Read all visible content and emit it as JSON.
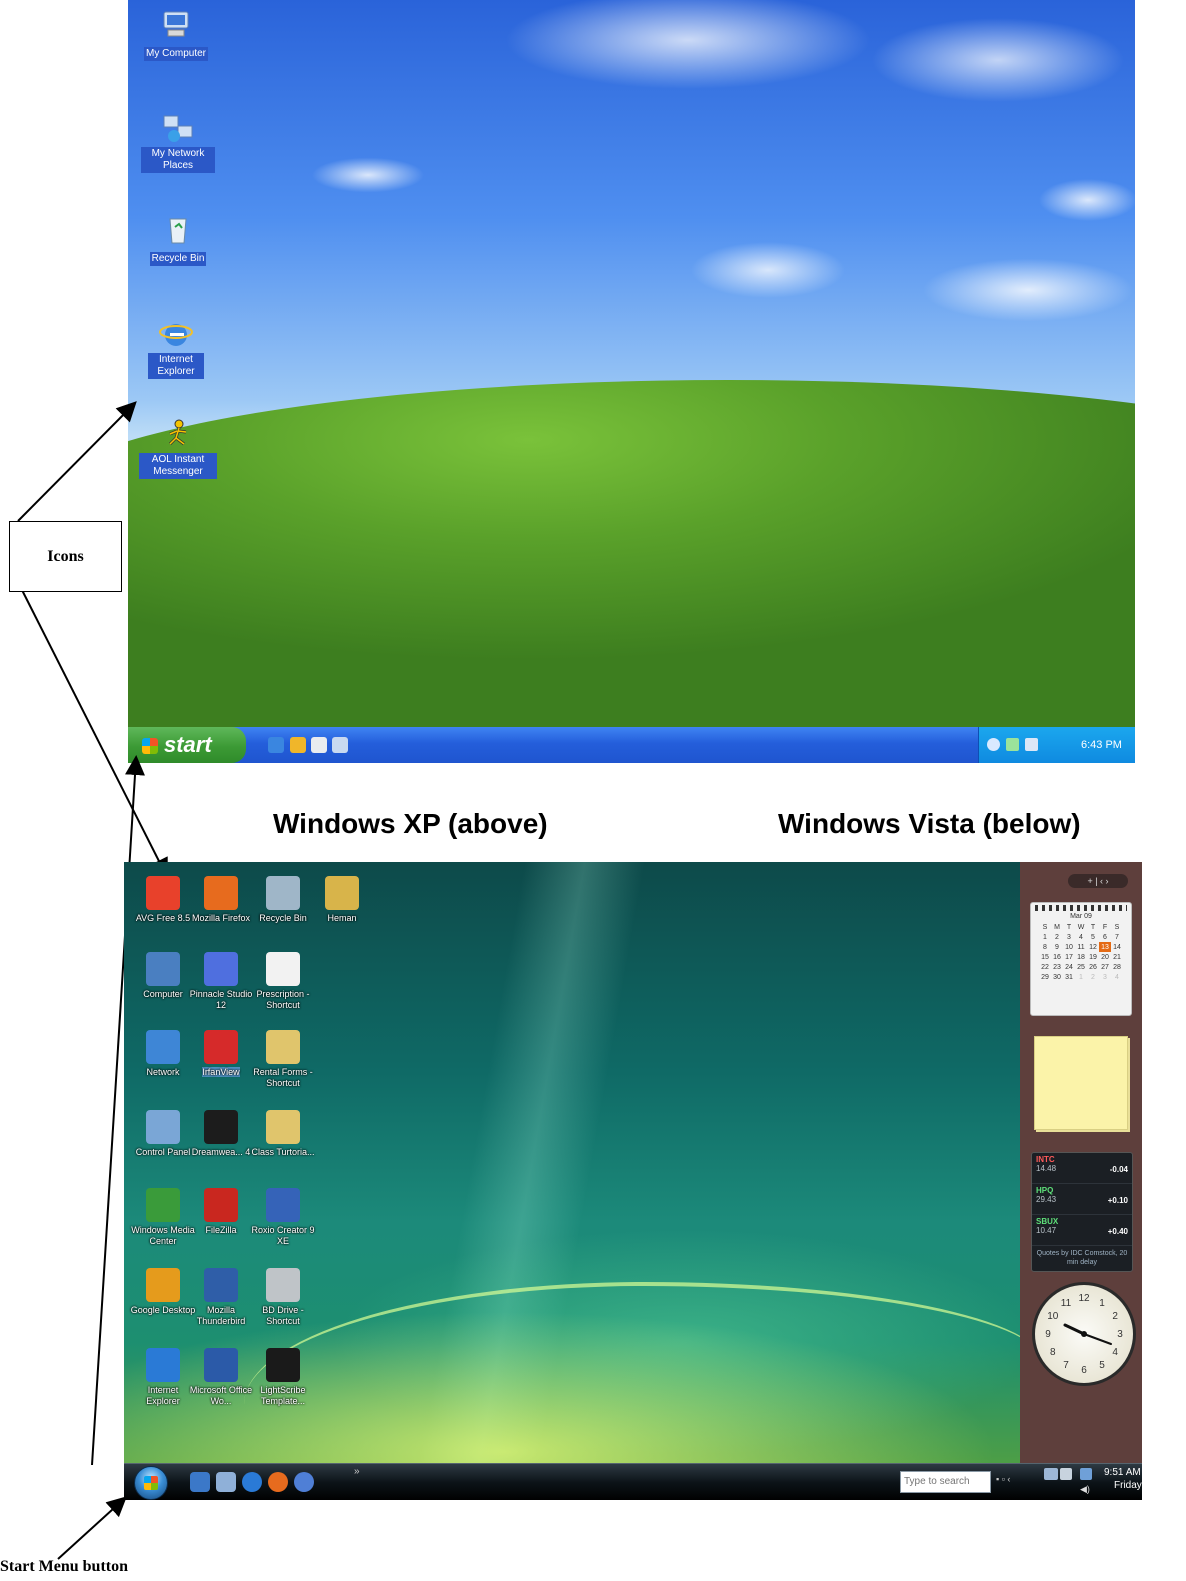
{
  "annotations": {
    "icons_label": "Icons",
    "xp_caption": "Windows XP (above)",
    "vista_caption": "Windows Vista (below)",
    "start_label": "Start Menu button"
  },
  "xp": {
    "icons": [
      {
        "name": "My Computer",
        "icon": "computer-icon"
      },
      {
        "name": "My Network Places",
        "icon": "network-places-icon"
      },
      {
        "name": "Recycle Bin",
        "icon": "recycle-bin-icon"
      },
      {
        "name": "Internet Explorer",
        "icon": "internet-explorer-icon"
      },
      {
        "name": "AOL Instant Messenger",
        "icon": "aim-icon"
      }
    ],
    "start_label": "start",
    "clock": "6:43 PM"
  },
  "vista": {
    "icons": [
      {
        "name": "AVG Free 8.5",
        "color": "#e8412b"
      },
      {
        "name": "Mozilla Firefox",
        "color": "#e76b1e"
      },
      {
        "name": "Recycle Bin",
        "color": "#9fb6c8"
      },
      {
        "name": "Heman",
        "color": "#d8b44a"
      },
      {
        "name": "Computer",
        "color": "#4a7fc1"
      },
      {
        "name": "Pinnacle Studio 12",
        "color": "#4f6fdf"
      },
      {
        "name": "Prescription - Shortcut",
        "color": "#f2f2f2"
      },
      {
        "name": "Network",
        "color": "#3e86d6"
      },
      {
        "name": "IrfanView",
        "color": "#d62a2a"
      },
      {
        "name": "Rental Forms - Shortcut",
        "color": "#e0c56c"
      },
      {
        "name": "Control Panel",
        "color": "#7aa6d6"
      },
      {
        "name": "Dreamwea... 4",
        "color": "#1c1c1c"
      },
      {
        "name": "Class Turtoria...",
        "color": "#e0c56c"
      },
      {
        "name": "Windows Media Center",
        "color": "#3a9b3a"
      },
      {
        "name": "FileZilla",
        "color": "#c9271f"
      },
      {
        "name": "Roxio Creator 9 XE",
        "color": "#3563b8"
      },
      {
        "name": "Google Desktop",
        "color": "#e59b1c"
      },
      {
        "name": "Mozilla Thunderbird",
        "color": "#2f5ea8"
      },
      {
        "name": "BD Drive - Shortcut",
        "color": "#bfc4c8"
      },
      {
        "name": "Internet Explorer",
        "color": "#2a7ad6"
      },
      {
        "name": "Microsoft Office Wo...",
        "color": "#2b5aa8"
      },
      {
        "name": "LightScribe Template...",
        "color": "#1a1a1a"
      }
    ],
    "search_placeholder": "Type to search",
    "time": "9:51 AM",
    "day": "Friday",
    "calendar": {
      "month": "Mar 09",
      "weekdays": [
        "S",
        "M",
        "T",
        "W",
        "T",
        "F",
        "S"
      ],
      "weeks": [
        [
          "1",
          "2",
          "3",
          "4",
          "5",
          "6",
          "7"
        ],
        [
          "8",
          "9",
          "10",
          "11",
          "12",
          "13",
          "14"
        ],
        [
          "15",
          "16",
          "17",
          "18",
          "19",
          "20",
          "21"
        ],
        [
          "22",
          "23",
          "24",
          "25",
          "26",
          "27",
          "28"
        ],
        [
          "29",
          "30",
          "31",
          "1",
          "2",
          "3",
          "4"
        ]
      ],
      "today": "13"
    },
    "stocks": [
      {
        "symbol": "INTC",
        "price": "14.48",
        "change": "-0.04",
        "color": "#ff5a5a"
      },
      {
        "symbol": "HPQ",
        "price": "29.43",
        "change": "+0.10",
        "color": "#5ee07a"
      },
      {
        "symbol": "SBUX",
        "price": "10.47",
        "change": "+0.40",
        "color": "#5ee07a"
      }
    ],
    "stocks_footer": "Quotes by IDC Comstock, 20 min delay",
    "clock_numbers": [
      "12",
      "1",
      "2",
      "3",
      "4",
      "5",
      "6",
      "7",
      "8",
      "9",
      "10",
      "11"
    ]
  }
}
